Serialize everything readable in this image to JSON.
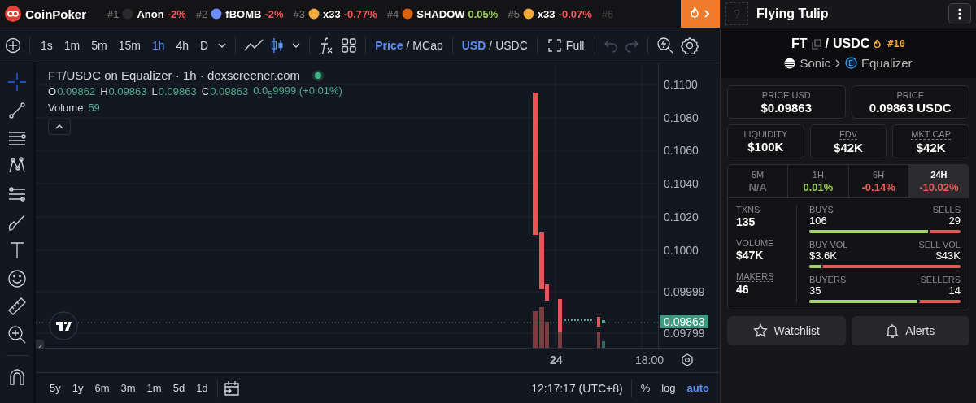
{
  "ticker": {
    "brand": "CoinPoker",
    "items": [
      {
        "rank": "#1",
        "name": "Anon",
        "change": "-2%",
        "color": "#ef5b5b"
      },
      {
        "rank": "#2",
        "name": "fBOMB",
        "change": "-2%",
        "color": "#ef5b5b"
      },
      {
        "rank": "#3",
        "name": "x33",
        "change": "-0.77%",
        "color": "#ef5b5b"
      },
      {
        "rank": "#4",
        "name": "SHADOW",
        "change": "0.05%",
        "color": "#9ccf5c"
      },
      {
        "rank": "#5",
        "name": "x33",
        "change": "-0.07%",
        "color": "#ef5b5b"
      }
    ],
    "trailing_rank": "#6"
  },
  "toolbar": {
    "intervals": [
      {
        "label": "1s",
        "selected": false
      },
      {
        "label": "1m",
        "selected": false
      },
      {
        "label": "5m",
        "selected": false
      },
      {
        "label": "15m",
        "selected": false
      },
      {
        "label": "1h",
        "selected": true
      },
      {
        "label": "4h",
        "selected": false
      },
      {
        "label": "D",
        "selected": false
      }
    ],
    "price_toggle": [
      {
        "label": "Price",
        "selected": true
      },
      {
        "label": "MCap",
        "selected": false
      }
    ],
    "price_separator": "/",
    "currency_toggle": [
      {
        "label": "USD",
        "selected": true
      },
      {
        "label": "USDC",
        "selected": false
      }
    ],
    "currency_separator": "/",
    "full_label": "Full"
  },
  "tools": [
    {
      "kind": "crosshair",
      "selected": true
    },
    {
      "kind": "trendline",
      "selected": false
    },
    {
      "kind": "fib",
      "selected": false
    },
    {
      "kind": "pattern",
      "selected": false
    },
    {
      "kind": "sliders",
      "selected": false
    },
    {
      "kind": "brush",
      "selected": false
    },
    {
      "kind": "text",
      "selected": false
    },
    {
      "kind": "emoji",
      "selected": false
    },
    {
      "kind": "ruler",
      "selected": false
    },
    {
      "kind": "zoom",
      "selected": false
    },
    {
      "kind": "magnet",
      "selected": false
    }
  ],
  "chart": {
    "title": "FT/USDC on Equalizer · 1h · dexscreener.com",
    "live": true,
    "ohlc": [
      {
        "key": "O",
        "value": "0.09862"
      },
      {
        "key": "H",
        "value": "0.09863"
      },
      {
        "key": "L",
        "value": "0.09863"
      },
      {
        "key": "C",
        "value": "0.09863"
      }
    ],
    "change": "0.0$_{5}$9999 (+0.01%)",
    "volume_label": "Volume",
    "volume": "59",
    "price_ticks": [
      {
        "label": "0.1100",
        "kind": "tick"
      },
      {
        "label": "0.1080",
        "kind": "tick"
      },
      {
        "label": "0.1060",
        "kind": "tick"
      },
      {
        "label": "0.1040",
        "kind": "tick"
      },
      {
        "label": "0.1020",
        "kind": "tick"
      },
      {
        "label": "0.1000",
        "kind": "tick"
      },
      {
        "label": "0.09999",
        "kind": "tick"
      },
      {
        "label": "0.09863",
        "kind": "current"
      },
      {
        "label": "0.09799",
        "kind": "tick"
      }
    ],
    "time_ticks": [
      {
        "label": "24",
        "bold": true
      },
      {
        "label": "18:00",
        "bold": false
      }
    ]
  },
  "bottom": {
    "ranges": [
      "5y",
      "1y",
      "6m",
      "3m",
      "1m",
      "5d",
      "1d"
    ],
    "clock": "12:17:17 (UTC+8)",
    "scale_options": [
      {
        "label": "%",
        "selected": false
      },
      {
        "label": "log",
        "selected": false
      },
      {
        "label": "auto",
        "selected": true
      }
    ]
  },
  "panel": {
    "name": "Flying Tulip",
    "base": "FT",
    "separator": "/",
    "quote": "USDC",
    "rank": "#10",
    "chain": "Sonic",
    "dex": "Equalizer",
    "price_cards": [
      {
        "label": "PRICE USD",
        "value": "$0.09863"
      },
      {
        "label": "PRICE",
        "value": "0.09863 USDC"
      }
    ],
    "metrics": [
      {
        "label": "LIQUIDITY",
        "value": "$100K",
        "dotted": false
      },
      {
        "label": "FDV",
        "value": "$42K",
        "dotted": true
      },
      {
        "label": "MKT CAP",
        "value": "$42K",
        "dotted": true
      }
    ],
    "periods": [
      {
        "label": "5M",
        "change": "N/A",
        "color": "#6b6b70",
        "selected": false
      },
      {
        "label": "1H",
        "change": "0.01%",
        "color": "#9ccf5c",
        "selected": false
      },
      {
        "label": "6H",
        "change": "-0.14%",
        "color": "#ef5b5b",
        "selected": false
      },
      {
        "label": "24H",
        "change": "-10.02%",
        "color": "#ef5b5b",
        "selected": true
      }
    ],
    "stats": [
      {
        "label": "TXNS",
        "value": "135",
        "dotted": false,
        "left_label": "BUYS",
        "left_value": "106",
        "right_label": "SELLS",
        "right_value": "29",
        "level": 0.785
      },
      {
        "label": "VOLUME",
        "value": "$47K",
        "dotted": false,
        "left_label": "BUY VOL",
        "left_value": "$3.6K",
        "right_label": "SELL VOL",
        "right_value": "$43K",
        "level": 0.077
      },
      {
        "label": "MAKERS",
        "value": "46",
        "dotted": true,
        "left_label": "BUYERS",
        "left_value": "35",
        "right_label": "SELLERS",
        "right_value": "14",
        "level": 0.714
      }
    ],
    "buttons": [
      "Watchlist",
      "Alerts"
    ]
  }
}
